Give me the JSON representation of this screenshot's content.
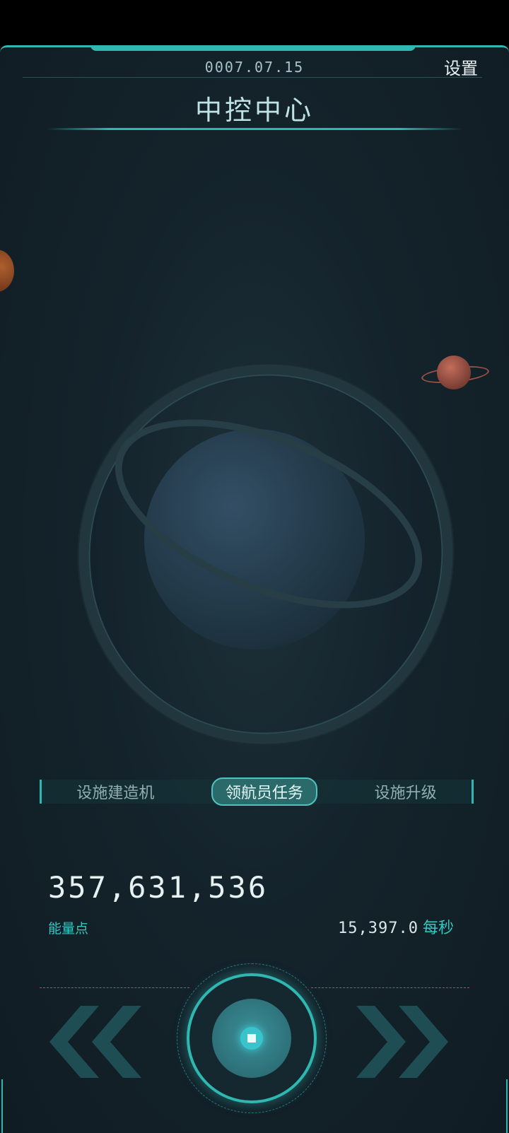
{
  "header": {
    "date": "0007.07.15",
    "settings_label": "设置",
    "title": "中控中心"
  },
  "tabs": [
    {
      "label": "设施建造机",
      "active": false
    },
    {
      "label": "领航员任务",
      "active": true
    },
    {
      "label": "设施升级",
      "active": false
    }
  ],
  "resources": {
    "energy_value": "357,631,536",
    "energy_label": "能量点",
    "rate_value": "15,397.0",
    "rate_unit": "每秒"
  },
  "colors": {
    "accent": "#2fb7b1",
    "background": "#14232b",
    "label_cyan": "#35c7c2"
  },
  "icons": {
    "prev": "double-chevron-left-icon",
    "next": "double-chevron-right-icon",
    "main": "core-button-icon"
  }
}
